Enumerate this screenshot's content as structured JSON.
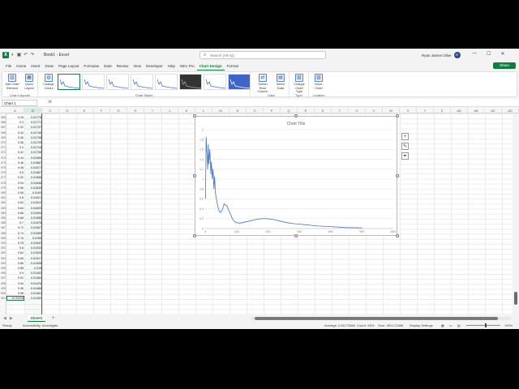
{
  "titlebar": {
    "app_logo": "X",
    "doc_title": "Book1 - Excel",
    "search_placeholder": "Search (Alt+Q)",
    "user_name": "Ryan James Olive",
    "user_initials": "R",
    "minimize": "—",
    "maximize": "☐",
    "close": "✕"
  },
  "tabs": [
    "File",
    "Home",
    "Insert",
    "Draw",
    "Page Layout",
    "Formulas",
    "Data",
    "Review",
    "View",
    "Developer",
    "Help",
    "Nitro Pro",
    "Chart Design",
    "Format"
  ],
  "share_label": "Share",
  "ribbon": {
    "chart_layouts": {
      "label": "Chart Layouts",
      "add_element": "Add Chart Element",
      "quick_layout": "Quick Layout"
    },
    "chart_styles": {
      "label": "Chart Styles",
      "change_colors": "Change Colors"
    },
    "data": {
      "label": "Data",
      "switch": "Switch Row/ Column",
      "select": "Select Data"
    },
    "type": {
      "label": "Type",
      "change": "Change Chart Type"
    },
    "location": {
      "label": "Location",
      "move": "Move Chart"
    }
  },
  "formula": {
    "name_box": "Chart 1",
    "fx": "fx"
  },
  "columns": [
    "A",
    "B",
    "C",
    "D",
    "E",
    "F",
    "G",
    "H",
    "I",
    "J",
    "K",
    "L",
    "M",
    "N",
    "O",
    "P",
    "Q",
    "R",
    "S",
    "T",
    "U",
    "V",
    "W",
    "X",
    "Y",
    "Z",
    "AA",
    "AB",
    "AC",
    "AD"
  ],
  "rows": [
    {
      "n": "465",
      "a": "9.28",
      "b": "0.01778"
    },
    {
      "n": "466",
      "a": "9.3",
      "b": "0.01771"
    },
    {
      "n": "467",
      "a": "9.32",
      "b": "0.01757"
    },
    {
      "n": "468",
      "a": "9.34",
      "b": "0.01746"
    },
    {
      "n": "469",
      "a": "9.36",
      "b": "0.01738"
    },
    {
      "n": "470",
      "a": "9.38",
      "b": "0.01729"
    },
    {
      "n": "471",
      "a": "9.4",
      "b": "0.01716"
    },
    {
      "n": "472",
      "a": "9.42",
      "b": "0.01706"
    },
    {
      "n": "473",
      "a": "9.44",
      "b": "0.01696"
    },
    {
      "n": "474",
      "a": "9.46",
      "b": "0.01687"
    },
    {
      "n": "475",
      "a": "9.48",
      "b": "0.01677"
    },
    {
      "n": "476",
      "a": "9.5",
      "b": "0.01667"
    },
    {
      "n": "477",
      "a": "9.52",
      "b": "0.01658"
    },
    {
      "n": "478",
      "a": "9.54",
      "b": "0.01648"
    },
    {
      "n": "479",
      "a": "9.56",
      "b": "0.01639"
    },
    {
      "n": "480",
      "a": "9.58",
      "b": "0.0163"
    },
    {
      "n": "481",
      "a": "9.6",
      "b": "0.01621"
    },
    {
      "n": "482",
      "a": "9.62",
      "b": "0.01612"
    },
    {
      "n": "483",
      "a": "9.64",
      "b": "0.01603"
    },
    {
      "n": "484",
      "a": "9.66",
      "b": "0.01594"
    },
    {
      "n": "485",
      "a": "9.68",
      "b": "0.01585"
    },
    {
      "n": "486",
      "a": "9.7",
      "b": "0.01576"
    },
    {
      "n": "487",
      "a": "9.72",
      "b": "0.01567"
    },
    {
      "n": "488",
      "a": "9.74",
      "b": "0.01559"
    },
    {
      "n": "489",
      "a": "9.76",
      "b": "0.0155"
    },
    {
      "n": "490",
      "a": "9.78",
      "b": "0.01542"
    },
    {
      "n": "491",
      "a": "9.8",
      "b": "0.01533"
    },
    {
      "n": "492",
      "a": "9.82",
      "b": "0.01525"
    },
    {
      "n": "493",
      "a": "9.84",
      "b": "0.01517"
    },
    {
      "n": "494",
      "a": "9.86",
      "b": "0.01508"
    },
    {
      "n": "495",
      "a": "9.88",
      "b": "0.015"
    },
    {
      "n": "496",
      "a": "9.9",
      "b": "0.01492"
    },
    {
      "n": "497",
      "a": "9.92",
      "b": "0.01484"
    },
    {
      "n": "498",
      "a": "9.94",
      "b": "0.01476"
    },
    {
      "n": "499",
      "a": "9.96",
      "b": "0.01468"
    },
    {
      "n": "500",
      "a": "9.98",
      "b": "0.01461"
    },
    {
      "n": "501",
      "a": "10.00000",
      "b": "0.01452"
    }
  ],
  "chart_data": {
    "type": "line",
    "title": "Chart Title",
    "xlim": [
      0,
      600
    ],
    "ylim": [
      0,
      2
    ],
    "xticks": [
      0,
      100,
      200,
      300,
      400,
      500,
      600
    ],
    "yticks": [
      0,
      0.2,
      0.4,
      0.6,
      0.8,
      1,
      1.2,
      1.4,
      1.6,
      1.8,
      2
    ],
    "grid": true,
    "series": [
      {
        "color": "#4472c4",
        "x": [
          1,
          3,
          5,
          8,
          10,
          12,
          15,
          18,
          20,
          23,
          25,
          28,
          30,
          33,
          36,
          40,
          45,
          50,
          55,
          60,
          70,
          80,
          85,
          90,
          95,
          100,
          110,
          120,
          140,
          160,
          180,
          200,
          220,
          240,
          260,
          280,
          300,
          330,
          360,
          400,
          450,
          500
        ],
        "y": [
          0.6,
          1.85,
          1.6,
          1.2,
          1.7,
          1.3,
          1.6,
          1.1,
          1.35,
          1.0,
          1.2,
          0.8,
          1.05,
          0.7,
          0.6,
          0.45,
          0.35,
          0.33,
          0.38,
          0.5,
          0.45,
          0.3,
          0.22,
          0.17,
          0.14,
          0.12,
          0.11,
          0.12,
          0.15,
          0.18,
          0.2,
          0.2,
          0.18,
          0.15,
          0.12,
          0.1,
          0.09,
          0.07,
          0.05,
          0.04,
          0.02,
          0.015
        ]
      }
    ]
  },
  "status": {
    "ready": "Ready",
    "accessibility": "Accessibility: Investigate",
    "average": "Average: 2.81173468",
    "count": "Count: 1001",
    "sum": "Sum: 2811.23468",
    "display": "Display Settings",
    "zoom": "100%"
  },
  "sheet": {
    "name": "Sheet1",
    "add": "+"
  },
  "colors": {
    "accent": "#107c41",
    "series": "#4472c4"
  }
}
